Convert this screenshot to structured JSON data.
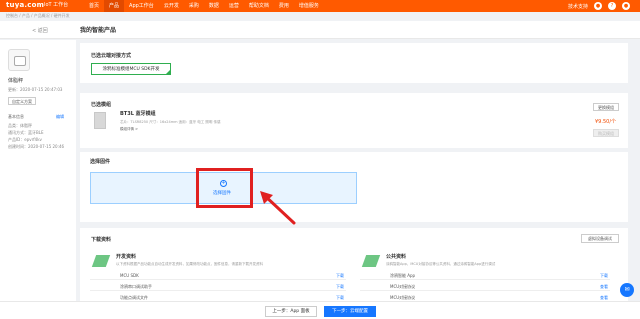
{
  "topbar": {
    "logo": "tuya.com",
    "logo_sub": "IoT 工作台",
    "nav": [
      "首页",
      "产品",
      "App工作台",
      "云开发",
      "采购",
      "数据",
      "运营",
      "帮助文档",
      "费用",
      "增值服务"
    ],
    "active_nav": "产品",
    "support": "技术支持"
  },
  "breadcrumb": "控制台 / 产品 / 产品概况 / 硬件开发",
  "subhead": {
    "back": "< 返回",
    "title": "我的智能产品"
  },
  "sidebar": {
    "product_name": "体脂秤",
    "updated": "更新：2020-07-15 20:47:03",
    "custom_btn": "自定义方案",
    "info_title": "基本信息",
    "info_edit": "编辑",
    "info_lines": [
      "品类：体脂秤",
      "通讯方式：蓝牙BLE",
      "产品ID：epvrf4kv",
      "创建时间：2020-07-15 20:46"
    ]
  },
  "method": {
    "title": "已选云端对接方式",
    "selected": "涂鸦标准模组MCU SDK开发"
  },
  "module": {
    "title": "已选模组",
    "change_btn": "更换模组",
    "name": "BT3L 蓝牙模组",
    "specs": "芯片：TLSR8250  尺寸：16x24mm  适用：蓝牙 电工 照明 传感",
    "more": "模组详情 >",
    "price": "¥9.50/个",
    "buy_btn": "购买模组"
  },
  "firmware": {
    "title": "选择固件",
    "select": "选择固件"
  },
  "download": {
    "title": "下载资料",
    "btn": "虚拟设备调试",
    "dev": {
      "head": "开发资料",
      "desc": "以下资料根据产品功能点自动生成开发资料，如果修改功能点，固件信息，请重新下载开发资料",
      "rows": [
        {
          "label": "MCU SDK",
          "action": "下载"
        },
        {
          "label": "涂鸦串口调试助手",
          "action": "下载"
        },
        {
          "label": "功能点调试文件",
          "action": "下载"
        }
      ]
    },
    "pub": {
      "head": "公共资料",
      "desc": "涂鸦智能App，MCU对接协议等公共资料，通过涂鸦智能App进行调试",
      "rows": [
        {
          "label": "涂鸦智能 App",
          "action": "下载"
        },
        {
          "label": "MCU对接协议",
          "action": "查看"
        },
        {
          "label": "MCU对接协议",
          "action": "查看"
        }
      ]
    }
  },
  "footer": {
    "prev": "上一步：App 面板",
    "next": "下一步：云端配置"
  },
  "chat_icon": "chat-icon"
}
